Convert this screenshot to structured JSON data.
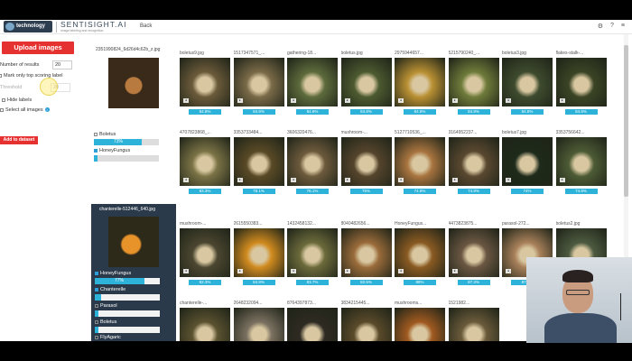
{
  "header": {
    "logo_text": "technology",
    "brand": "SENTISIGHT.AI",
    "tagline": "image labeling and recognition",
    "back_label": "Back"
  },
  "left": {
    "upload_label": "Upload images",
    "results_label": "Number of results",
    "results_value": "20",
    "top_scoring_label": "Mark only top scoring label",
    "threshold_label": "Threshold",
    "threshold_value": "20",
    "hide_labels": "Hide labels",
    "select_all": "Select all images",
    "add_dataset": "Add to dataset"
  },
  "query1": {
    "filename": "2351990824_6d26d4c62b_z.jpg",
    "predictions": [
      {
        "label": "Boletus",
        "checked": false,
        "score": "73%",
        "fraction": 0.73
      },
      {
        "label": "HoneyFungus",
        "checked": true,
        "score": "",
        "fraction": 0.05
      }
    ]
  },
  "query2": {
    "filename": "chanterelle-512446_640.jpg",
    "predictions": [
      {
        "label": "HoneyFungus",
        "checked": true,
        "score": "77%",
        "fraction": 0.77
      },
      {
        "label": "Chanterelle",
        "checked": true,
        "score": "",
        "fraction": 0.1
      },
      {
        "label": "Parasol",
        "checked": false,
        "score": "",
        "fraction": 0.05
      },
      {
        "label": "Boletus",
        "checked": false,
        "score": "",
        "fraction": 0.05
      },
      {
        "label": "FlyAgaric",
        "checked": false,
        "score": "",
        "fraction": 0.0
      }
    ]
  },
  "grid1": [
    {
      "name": "boletus9.jpg",
      "score": "84.8%",
      "color": "#6b5a3a"
    },
    {
      "name": "1517347571_...",
      "score": "84.8%",
      "color": "#7a6a48"
    },
    {
      "name": "gathering-18...",
      "score": "84.8%",
      "color": "#5d6b3c"
    },
    {
      "name": "boletus.jpg",
      "score": "84.8%",
      "color": "#4c5a30"
    },
    {
      "name": "2975944657...",
      "score": "84.8%",
      "color": "#b99033"
    },
    {
      "name": "5215790240_...",
      "score": "84.8%",
      "color": "#6e7b3a"
    },
    {
      "name": "boletus3.jpg",
      "score": "84.8%",
      "color": "#3e4b2e"
    },
    {
      "name": "flakes-stalk-...",
      "score": "84.8%",
      "color": "#3b4425"
    },
    {
      "name": "4707823868_...",
      "score": "83.3%",
      "color": "#7b7346"
    },
    {
      "name": "3353733484...",
      "score": "78.1%",
      "color": "#5a4a26"
    },
    {
      "name": "3606320476...",
      "score": "76.1%",
      "color": "#6d5a3c"
    },
    {
      "name": "mushroom-...",
      "score": "75%",
      "color": "#55442c"
    },
    {
      "name": "5127710536_...",
      "score": "74.8%",
      "color": "#a8743f"
    },
    {
      "name": "3164952237...",
      "score": "74.8%",
      "color": "#5a4830"
    },
    {
      "name": "boletus7.jpg",
      "score": "74%",
      "color": "#1e2a1a"
    },
    {
      "name": "3353756642...",
      "score": "74.8%",
      "color": "#4d5b35"
    }
  ],
  "grid2": [
    {
      "name": "mushroom-...",
      "score": "82.3%",
      "color": "#4b4630"
    },
    {
      "name": "2615550383...",
      "score": "84.8%",
      "color": "#d08a1e"
    },
    {
      "name": "1432458132...",
      "score": "83.7%",
      "color": "#6b6a3b"
    },
    {
      "name": "8040482656...",
      "score": "82.5%",
      "color": "#9a6b3a"
    },
    {
      "name": "HoneyFungus...",
      "score": "88%",
      "color": "#8a5a22"
    },
    {
      "name": "4473823875...",
      "score": "87.3%",
      "color": "#6a5642"
    },
    {
      "name": "parasol-272...",
      "score": "87.3%",
      "color": "#a8805a"
    },
    {
      "name": "boletus2.jpg",
      "score": "87.3%",
      "color": "#4d5a40"
    },
    {
      "name": "chanterelle-...",
      "score": "",
      "color": "#5b5230"
    },
    {
      "name": "2648232094...",
      "score": "",
      "color": "#7a7060"
    },
    {
      "name": "8764397873...",
      "score": "",
      "color": "#2e2a22"
    },
    {
      "name": "3834215445...",
      "score": "",
      "color": "#5a4a2a"
    },
    {
      "name": "mushrooms...",
      "score": "",
      "color": "#a05a20"
    },
    {
      "name": "1521982...",
      "score": "",
      "color": "#6a5a3a"
    }
  ]
}
